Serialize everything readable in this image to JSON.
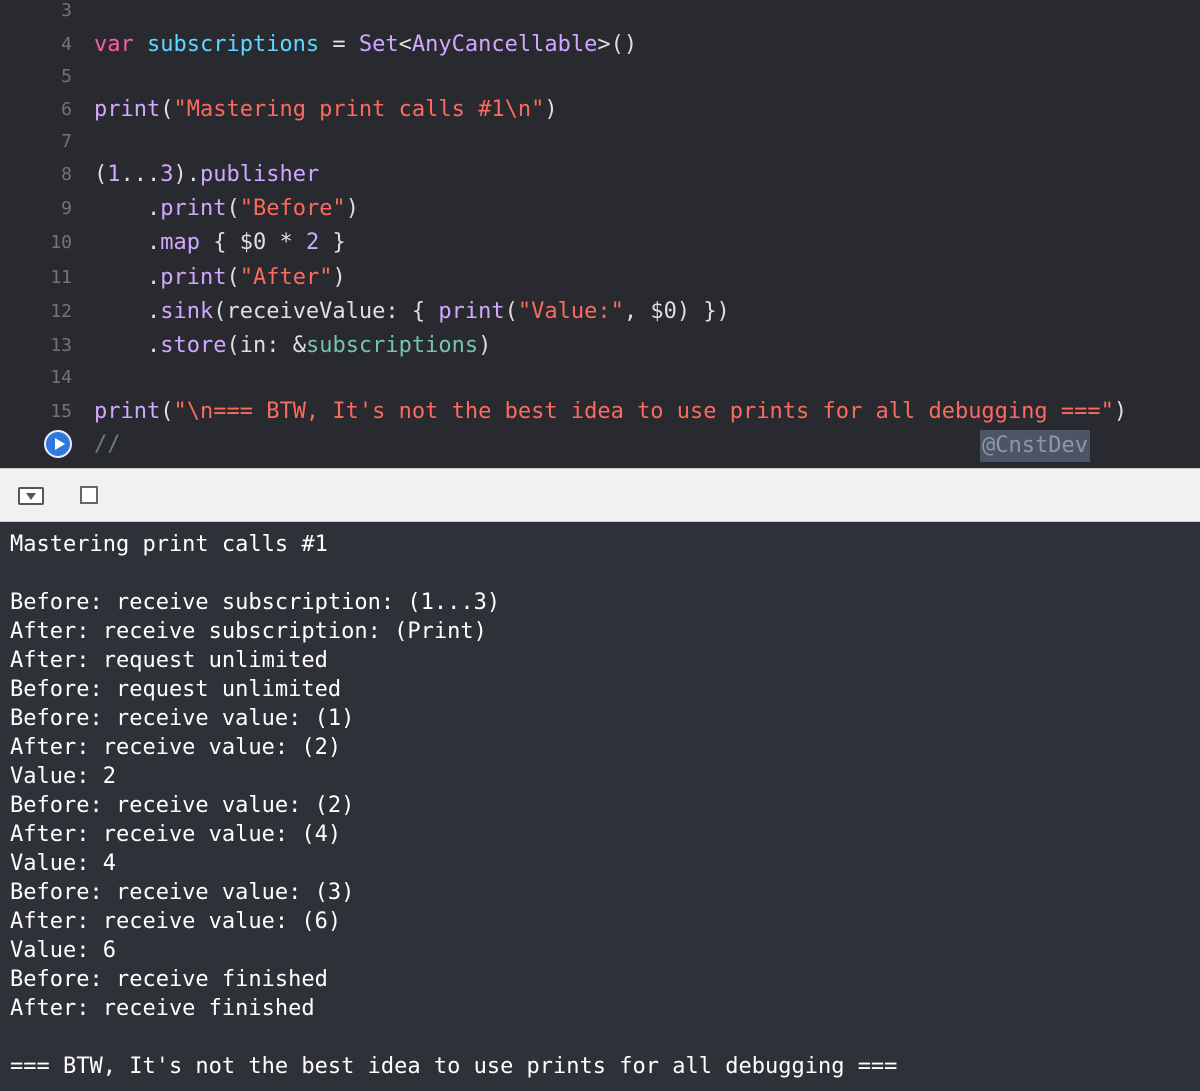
{
  "editor": {
    "lines": [
      {
        "n": "3",
        "segs": []
      },
      {
        "n": "4",
        "segs": [
          {
            "t": "var ",
            "c": "kw"
          },
          {
            "t": "subscriptions",
            "c": "vr"
          },
          {
            "t": " = ",
            "c": "pl"
          },
          {
            "t": "Set",
            "c": "ty"
          },
          {
            "t": "<",
            "c": "pl"
          },
          {
            "t": "AnyCancellable",
            "c": "ty"
          },
          {
            "t": ">()",
            "c": "pl"
          }
        ]
      },
      {
        "n": "5",
        "segs": []
      },
      {
        "n": "6",
        "segs": [
          {
            "t": "print",
            "c": "ty"
          },
          {
            "t": "(",
            "c": "pl"
          },
          {
            "t": "\"Mastering print calls #1\\n\"",
            "c": "st"
          },
          {
            "t": ")",
            "c": "pl"
          }
        ]
      },
      {
        "n": "7",
        "segs": []
      },
      {
        "n": "8",
        "segs": [
          {
            "t": "(",
            "c": "pl"
          },
          {
            "t": "1",
            "c": "ty"
          },
          {
            "t": "...",
            "c": "pl"
          },
          {
            "t": "3",
            "c": "ty"
          },
          {
            "t": ").",
            "c": "pl"
          },
          {
            "t": "publisher",
            "c": "ty"
          }
        ]
      },
      {
        "n": "9",
        "segs": [
          {
            "t": "    .",
            "c": "pl"
          },
          {
            "t": "print",
            "c": "ty"
          },
          {
            "t": "(",
            "c": "pl"
          },
          {
            "t": "\"Before\"",
            "c": "st"
          },
          {
            "t": ")",
            "c": "pl"
          }
        ]
      },
      {
        "n": "10",
        "segs": [
          {
            "t": "    .",
            "c": "pl"
          },
          {
            "t": "map",
            "c": "ty"
          },
          {
            "t": " { $0 ",
            "c": "pl"
          },
          {
            "t": "*",
            "c": "pl"
          },
          {
            "t": " ",
            "c": "pl"
          },
          {
            "t": "2",
            "c": "ty"
          },
          {
            "t": " }",
            "c": "pl"
          }
        ]
      },
      {
        "n": "11",
        "segs": [
          {
            "t": "    .",
            "c": "pl"
          },
          {
            "t": "print",
            "c": "ty"
          },
          {
            "t": "(",
            "c": "pl"
          },
          {
            "t": "\"After\"",
            "c": "st"
          },
          {
            "t": ")",
            "c": "pl"
          }
        ]
      },
      {
        "n": "12",
        "segs": [
          {
            "t": "    .",
            "c": "pl"
          },
          {
            "t": "sink",
            "c": "ty"
          },
          {
            "t": "(receiveValue: { ",
            "c": "pl"
          },
          {
            "t": "print",
            "c": "ty"
          },
          {
            "t": "(",
            "c": "pl"
          },
          {
            "t": "\"Value:\"",
            "c": "st"
          },
          {
            "t": ", $0) })",
            "c": "pl"
          }
        ]
      },
      {
        "n": "13",
        "segs": [
          {
            "t": "    .",
            "c": "pl"
          },
          {
            "t": "store",
            "c": "ty"
          },
          {
            "t": "(in: &",
            "c": "pl"
          },
          {
            "t": "subscriptions",
            "c": "sub"
          },
          {
            "t": ")",
            "c": "pl"
          }
        ]
      },
      {
        "n": "14",
        "segs": []
      },
      {
        "n": "15",
        "segs": [
          {
            "t": "print",
            "c": "ty"
          },
          {
            "t": "(",
            "c": "pl"
          },
          {
            "t": "\"\\n=== BTW, It's not the best idea to use prints for all debugging ===\"",
            "c": "st"
          },
          {
            "t": ")",
            "c": "pl"
          }
        ]
      },
      {
        "n": "",
        "segs": [
          {
            "t": "//",
            "c": "cm"
          }
        ]
      }
    ],
    "watermark": "@CnstDev"
  },
  "console": {
    "lines": [
      "Mastering print calls #1",
      "",
      "Before: receive subscription: (1...3)",
      "After: receive subscription: (Print)",
      "After: request unlimited",
      "Before: request unlimited",
      "Before: receive value: (1)",
      "After: receive value: (2)",
      "Value: 2",
      "Before: receive value: (2)",
      "After: receive value: (4)",
      "Value: 4",
      "Before: receive value: (3)",
      "After: receive value: (6)",
      "Value: 6",
      "Before: receive finished",
      "After: receive finished",
      "",
      "=== BTW, It's not the best idea to use prints for all debugging ==="
    ]
  },
  "colors": {
    "editor_bg": "#292a30",
    "console_bg": "#2f3138",
    "keyword": "#fc5fa3",
    "type": "#d0a8ff",
    "string": "#fc6a5d",
    "run_button": "#2d79e0"
  },
  "icons": {
    "run": "play-circle-icon",
    "debug_toggle": "hide-debug-area-icon",
    "console_toggle": "square-icon"
  }
}
